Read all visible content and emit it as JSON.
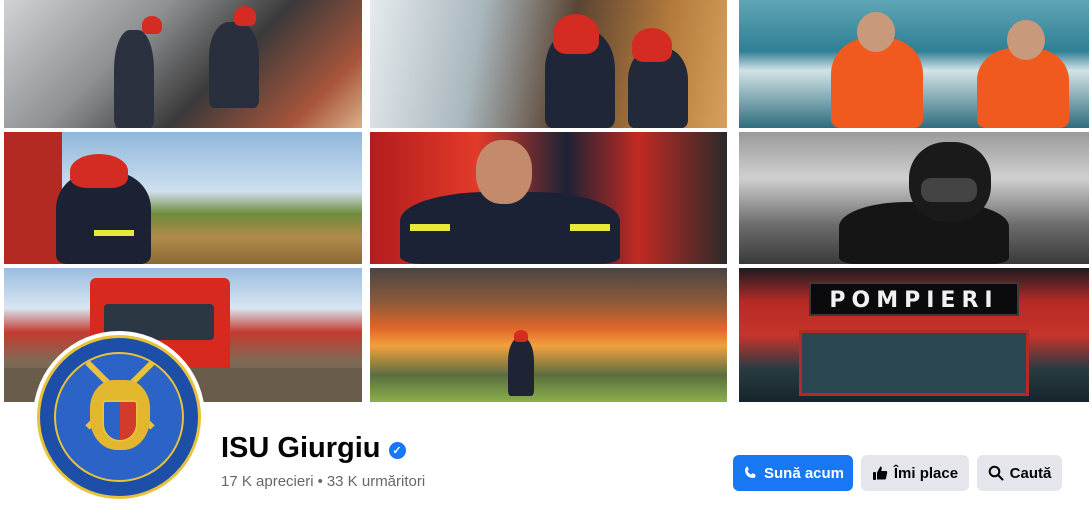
{
  "cover": {
    "tiles": [
      {
        "id": "firefighters-roof-fire"
      },
      {
        "id": "firefighters-hose"
      },
      {
        "id": "rescue-boat-crew"
      },
      {
        "id": "firefighter-field"
      },
      {
        "id": "firefighter-heart-gesture"
      },
      {
        "id": "diver"
      },
      {
        "id": "fire-truck-flood"
      },
      {
        "id": "firefighter-grass-fire"
      },
      {
        "id": "fire-truck-cabin"
      }
    ],
    "sign_text": "POMPIERI"
  },
  "profile": {
    "avatar_icon": "isu-emblem"
  },
  "page": {
    "name": "ISU Giurgiu",
    "verified": true,
    "likes": "17 K aprecieri",
    "separator": "•",
    "followers": "33 K urmăritori"
  },
  "actions": {
    "call_label": "Sună acum",
    "like_label": "Îmi place",
    "search_label": "Caută"
  },
  "colors": {
    "primary": "#1877f2",
    "secondary_button": "#e4e6eb",
    "text_primary": "#050505",
    "text_secondary": "#65676b"
  }
}
